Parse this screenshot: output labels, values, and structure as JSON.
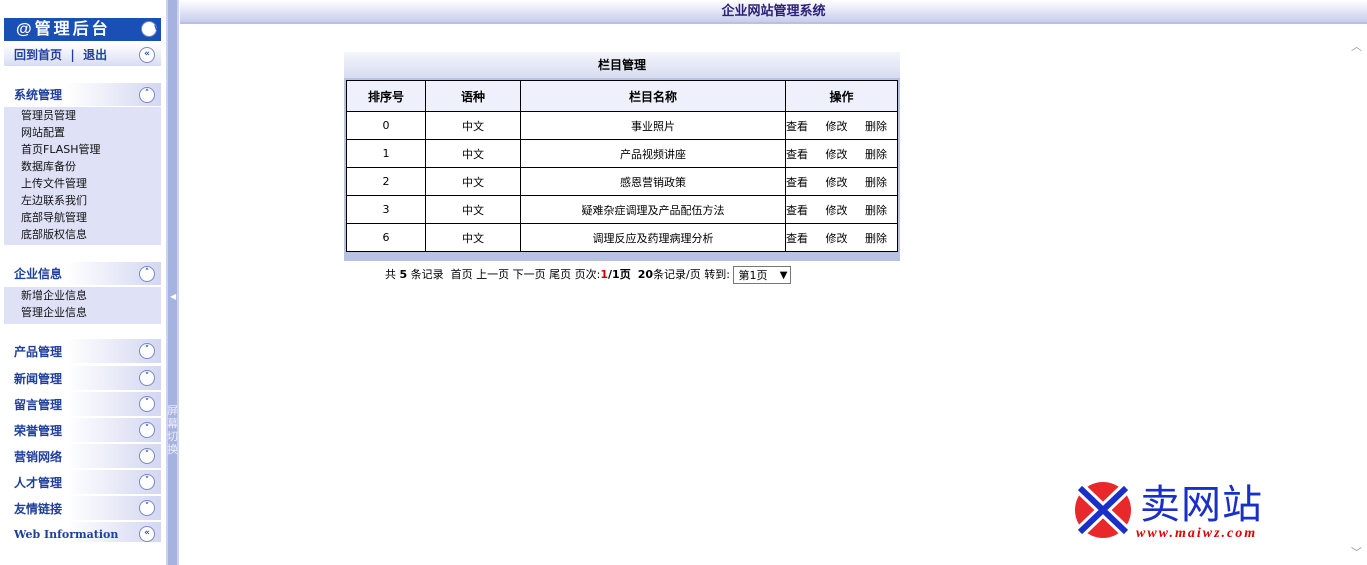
{
  "sidebar": {
    "brand": "@管理后台",
    "home_link": "回到首页",
    "separator": "|",
    "logout_link": "退出",
    "sections_open": [
      {
        "title": "系统管理",
        "items": [
          "管理员管理",
          "网站配置",
          "首页FLASH管理",
          "数据库备份",
          "上传文件管理",
          "左边联系我们",
          "底部导航管理",
          "底部版权信息"
        ]
      },
      {
        "title": "企业信息",
        "items": [
          "新增企业信息",
          "管理企业信息"
        ]
      }
    ],
    "sections_collapsed": [
      "产品管理",
      "新闻管理",
      "留言管理",
      "荣誉管理",
      "营销网络",
      "人才管理",
      "友情链接",
      "Web Information"
    ]
  },
  "splitter": {
    "label": "屏幕切换"
  },
  "header": {
    "title": "企业网站管理系统"
  },
  "panel": {
    "title": "栏目管理",
    "columns": [
      "排序号",
      "语种",
      "栏目名称",
      "操作"
    ],
    "rows": [
      {
        "order": "0",
        "lang": "中文",
        "name": "事业照片"
      },
      {
        "order": "1",
        "lang": "中文",
        "name": "产品视频讲座"
      },
      {
        "order": "2",
        "lang": "中文",
        "name": "感恩营销政策"
      },
      {
        "order": "3",
        "lang": "中文",
        "name": "疑难杂症调理及产品配伍方法"
      },
      {
        "order": "6",
        "lang": "中文",
        "name": "调理反应及药理病理分析"
      }
    ],
    "actions": [
      "查看",
      "修改",
      "删除"
    ]
  },
  "pager": {
    "total_prefix": "共",
    "total": "5",
    "total_suffix": "条记录",
    "first": "首页",
    "prev": "上一页",
    "next": "下一页",
    "last": "尾页",
    "pageinfo_label": "页次:",
    "current": "1",
    "slash_pages": "/1页",
    "per_page": "20",
    "per_page_suffix": "条记录/页",
    "goto_label": "转到:",
    "goto_value": "第1页"
  },
  "watermark": {
    "word": "卖网站",
    "url": "www.maiwz.com"
  },
  "colors": {
    "brand_bg": "#1a4fb5",
    "nav_text": "#1f3f9c",
    "panel_border": "#b8c3e3"
  }
}
